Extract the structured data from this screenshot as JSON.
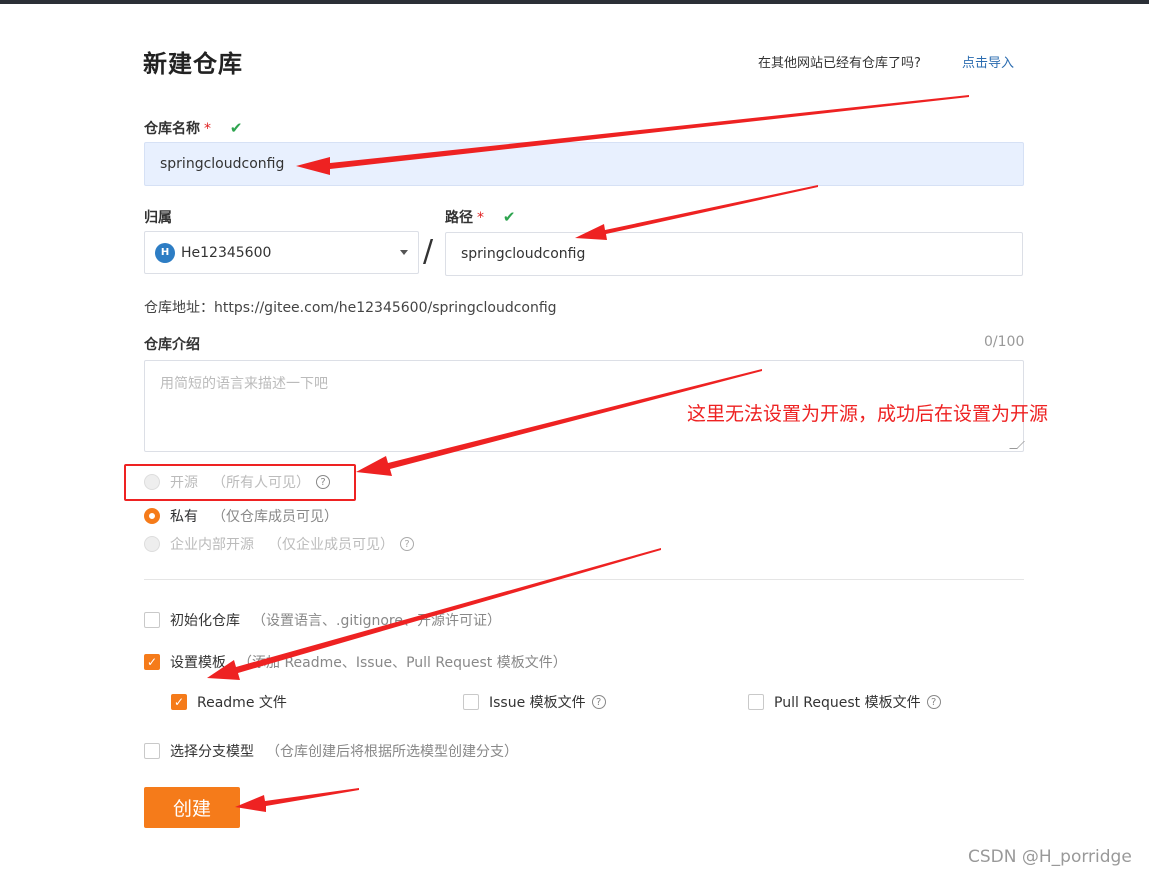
{
  "page": {
    "title": "新建仓库",
    "import_question": "在其他网站已经有仓库了吗?",
    "import_link": "点击导入"
  },
  "repo_name": {
    "label": "仓库名称",
    "required_mark": "*",
    "value": "springcloudconfig"
  },
  "owner": {
    "label": "归属",
    "avatar_letter": "H",
    "value": "He12345600"
  },
  "path": {
    "separator": "/",
    "label": "路径",
    "required_mark": "*",
    "value": "springcloudconfig"
  },
  "repo_address": "仓库地址：https://gitee.com/he12345600/springcloudconfig",
  "description": {
    "label": "仓库介绍",
    "counter": "0/100",
    "placeholder": "用简短的语言来描述一下吧"
  },
  "visibility": {
    "options": [
      {
        "label": "开源",
        "hint": "（所有人可见）",
        "state": "disabled"
      },
      {
        "label": "私有",
        "hint": "（仅仓库成员可见）",
        "state": "selected"
      },
      {
        "label": "企业内部开源",
        "hint": "（仅企业成员可见）",
        "state": "disabled"
      }
    ]
  },
  "options": {
    "init_repo": {
      "label": "初始化仓库",
      "hint": "（设置语言、.gitignore、开源许可证）",
      "checked": false
    },
    "template": {
      "label": "设置模板",
      "hint": "（添加 Readme、Issue、Pull Request 模板文件）",
      "checked": true
    },
    "template_files": [
      {
        "label": "Readme 文件",
        "checked": true
      },
      {
        "label": "Issue 模板文件",
        "checked": false
      },
      {
        "label": "Pull Request 模板文件",
        "checked": false
      }
    ],
    "branch_model": {
      "label": "选择分支模型",
      "hint": "（仓库创建后将根据所选模型创建分支）",
      "checked": false
    }
  },
  "create_button": "创建",
  "annotation": "这里无法设置为开源，成功后在设置为开源",
  "watermark": "CSDN @H_porridge",
  "colors": {
    "accent": "#f57b1a",
    "annotation_red": "#ee2222",
    "link": "#2b6cb0",
    "ok_green": "#2ea44f"
  },
  "icons": {
    "valid": "check-icon",
    "help": "question-circle-icon",
    "dropdown": "caret-down-icon"
  }
}
